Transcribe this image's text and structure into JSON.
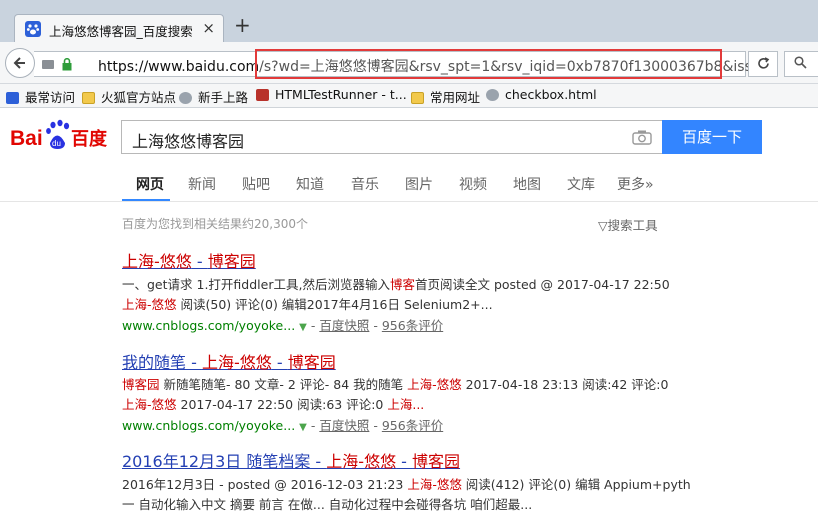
{
  "browser": {
    "tab_title": "上海悠悠博客园_百度搜索",
    "new_tab": "+",
    "close": "×",
    "url_host": "https://www.baidu.com",
    "url_rest": "/s?wd=上海悠悠博客园&rsv_spt=1&rsv_iqid=0xb7870f13000367b8&issp"
  },
  "bookmarks": [
    {
      "label": "最常访问",
      "icon": "blue"
    },
    {
      "label": "火狐官方站点",
      "icon": "folder"
    },
    {
      "label": "新手上路",
      "icon": "globe"
    },
    {
      "label": "HTMLTestRunner - t...",
      "icon": "red"
    },
    {
      "label": "常用网址",
      "icon": "folder"
    },
    {
      "label": "checkbox.html",
      "icon": "globe"
    }
  ],
  "search": {
    "query": "上海悠悠博客园",
    "button": "百度一下",
    "logo_text": "百度"
  },
  "categories": [
    "网页",
    "新闻",
    "贴吧",
    "知道",
    "音乐",
    "图片",
    "视频",
    "地图",
    "文库",
    "更多»"
  ],
  "results_count": "百度为您找到相关结果约20,300个",
  "search_tools": "搜索工具",
  "results": [
    {
      "title_parts": [
        "上海-悠悠",
        " - ",
        "博客园"
      ],
      "line1": [
        "一、get请求 1.打开fiddler工具,然后浏览器输入",
        "博客",
        "首页阅读全文 posted @ 2017-04-17 22:50"
      ],
      "line2": [
        "上海-悠悠",
        " 阅读(50) 评论(0) 编辑2017年4月16日 Selenium2+..."
      ],
      "url": "www.cnblogs.com/yoyoke...",
      "snap": "百度快照",
      "rating": "956条评价"
    },
    {
      "title_parts": [
        "我的随笔 - ",
        "上海-悠悠",
        " - ",
        "博客园"
      ],
      "line1": [
        "博客园",
        " 新随笔随笔- 80 文章- 2 评论- 84 我的随笔 ",
        "上海-悠悠",
        " 2017-04-18 23:13 阅读:42 评论:0"
      ],
      "line2": [
        "上海-悠悠",
        " 2017-04-17 22:50 阅读:63 评论:0 ",
        "上海...",
        ""
      ],
      "url": "www.cnblogs.com/yoyoke...",
      "snap": "百度快照",
      "rating": "956条评价"
    },
    {
      "title_parts": [
        "2016年12月3日 随笔档案 - ",
        "上海-悠悠",
        " - ",
        "博客园"
      ],
      "line1": [
        "2016年12月3日 - posted @ 2016-12-03 21:23 ",
        "上海-悠悠",
        " 阅读(412) 评论(0) 编辑 Appium+pyth"
      ],
      "line2": [
        "一 自动化输入中文 摘要 前言 在做... 自动化过程中会碰得各坑 咱们超最..."
      ]
    }
  ]
}
